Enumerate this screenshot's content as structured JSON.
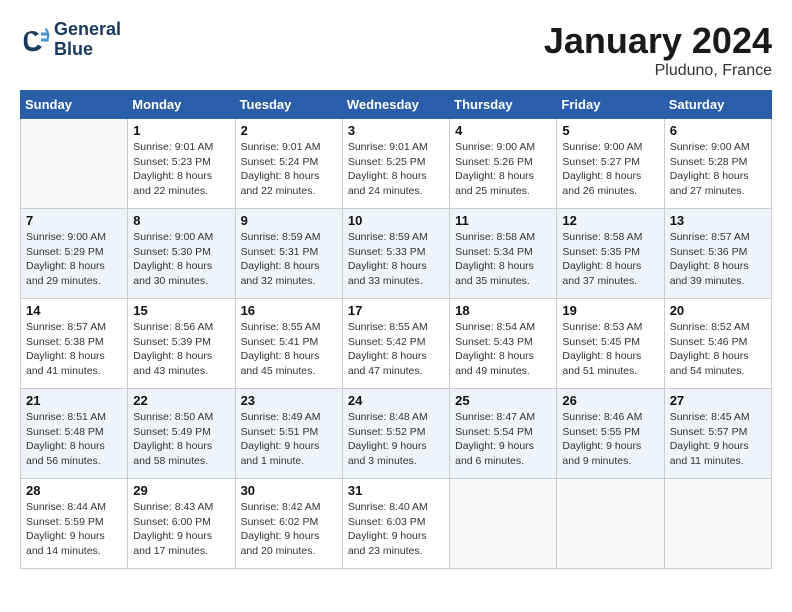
{
  "header": {
    "logo_line1": "General",
    "logo_line2": "Blue",
    "month": "January 2024",
    "location": "Pluduno, France"
  },
  "weekdays": [
    "Sunday",
    "Monday",
    "Tuesday",
    "Wednesday",
    "Thursday",
    "Friday",
    "Saturday"
  ],
  "weeks": [
    [
      {
        "day": "",
        "sunrise": "",
        "sunset": "",
        "daylight": ""
      },
      {
        "day": "1",
        "sunrise": "Sunrise: 9:01 AM",
        "sunset": "Sunset: 5:23 PM",
        "daylight": "Daylight: 8 hours and 22 minutes."
      },
      {
        "day": "2",
        "sunrise": "Sunrise: 9:01 AM",
        "sunset": "Sunset: 5:24 PM",
        "daylight": "Daylight: 8 hours and 22 minutes."
      },
      {
        "day": "3",
        "sunrise": "Sunrise: 9:01 AM",
        "sunset": "Sunset: 5:25 PM",
        "daylight": "Daylight: 8 hours and 24 minutes."
      },
      {
        "day": "4",
        "sunrise": "Sunrise: 9:00 AM",
        "sunset": "Sunset: 5:26 PM",
        "daylight": "Daylight: 8 hours and 25 minutes."
      },
      {
        "day": "5",
        "sunrise": "Sunrise: 9:00 AM",
        "sunset": "Sunset: 5:27 PM",
        "daylight": "Daylight: 8 hours and 26 minutes."
      },
      {
        "day": "6",
        "sunrise": "Sunrise: 9:00 AM",
        "sunset": "Sunset: 5:28 PM",
        "daylight": "Daylight: 8 hours and 27 minutes."
      }
    ],
    [
      {
        "day": "7",
        "sunrise": "Sunrise: 9:00 AM",
        "sunset": "Sunset: 5:29 PM",
        "daylight": "Daylight: 8 hours and 29 minutes."
      },
      {
        "day": "8",
        "sunrise": "Sunrise: 9:00 AM",
        "sunset": "Sunset: 5:30 PM",
        "daylight": "Daylight: 8 hours and 30 minutes."
      },
      {
        "day": "9",
        "sunrise": "Sunrise: 8:59 AM",
        "sunset": "Sunset: 5:31 PM",
        "daylight": "Daylight: 8 hours and 32 minutes."
      },
      {
        "day": "10",
        "sunrise": "Sunrise: 8:59 AM",
        "sunset": "Sunset: 5:33 PM",
        "daylight": "Daylight: 8 hours and 33 minutes."
      },
      {
        "day": "11",
        "sunrise": "Sunrise: 8:58 AM",
        "sunset": "Sunset: 5:34 PM",
        "daylight": "Daylight: 8 hours and 35 minutes."
      },
      {
        "day": "12",
        "sunrise": "Sunrise: 8:58 AM",
        "sunset": "Sunset: 5:35 PM",
        "daylight": "Daylight: 8 hours and 37 minutes."
      },
      {
        "day": "13",
        "sunrise": "Sunrise: 8:57 AM",
        "sunset": "Sunset: 5:36 PM",
        "daylight": "Daylight: 8 hours and 39 minutes."
      }
    ],
    [
      {
        "day": "14",
        "sunrise": "Sunrise: 8:57 AM",
        "sunset": "Sunset: 5:38 PM",
        "daylight": "Daylight: 8 hours and 41 minutes."
      },
      {
        "day": "15",
        "sunrise": "Sunrise: 8:56 AM",
        "sunset": "Sunset: 5:39 PM",
        "daylight": "Daylight: 8 hours and 43 minutes."
      },
      {
        "day": "16",
        "sunrise": "Sunrise: 8:55 AM",
        "sunset": "Sunset: 5:41 PM",
        "daylight": "Daylight: 8 hours and 45 minutes."
      },
      {
        "day": "17",
        "sunrise": "Sunrise: 8:55 AM",
        "sunset": "Sunset: 5:42 PM",
        "daylight": "Daylight: 8 hours and 47 minutes."
      },
      {
        "day": "18",
        "sunrise": "Sunrise: 8:54 AM",
        "sunset": "Sunset: 5:43 PM",
        "daylight": "Daylight: 8 hours and 49 minutes."
      },
      {
        "day": "19",
        "sunrise": "Sunrise: 8:53 AM",
        "sunset": "Sunset: 5:45 PM",
        "daylight": "Daylight: 8 hours and 51 minutes."
      },
      {
        "day": "20",
        "sunrise": "Sunrise: 8:52 AM",
        "sunset": "Sunset: 5:46 PM",
        "daylight": "Daylight: 8 hours and 54 minutes."
      }
    ],
    [
      {
        "day": "21",
        "sunrise": "Sunrise: 8:51 AM",
        "sunset": "Sunset: 5:48 PM",
        "daylight": "Daylight: 8 hours and 56 minutes."
      },
      {
        "day": "22",
        "sunrise": "Sunrise: 8:50 AM",
        "sunset": "Sunset: 5:49 PM",
        "daylight": "Daylight: 8 hours and 58 minutes."
      },
      {
        "day": "23",
        "sunrise": "Sunrise: 8:49 AM",
        "sunset": "Sunset: 5:51 PM",
        "daylight": "Daylight: 9 hours and 1 minute."
      },
      {
        "day": "24",
        "sunrise": "Sunrise: 8:48 AM",
        "sunset": "Sunset: 5:52 PM",
        "daylight": "Daylight: 9 hours and 3 minutes."
      },
      {
        "day": "25",
        "sunrise": "Sunrise: 8:47 AM",
        "sunset": "Sunset: 5:54 PM",
        "daylight": "Daylight: 9 hours and 6 minutes."
      },
      {
        "day": "26",
        "sunrise": "Sunrise: 8:46 AM",
        "sunset": "Sunset: 5:55 PM",
        "daylight": "Daylight: 9 hours and 9 minutes."
      },
      {
        "day": "27",
        "sunrise": "Sunrise: 8:45 AM",
        "sunset": "Sunset: 5:57 PM",
        "daylight": "Daylight: 9 hours and 11 minutes."
      }
    ],
    [
      {
        "day": "28",
        "sunrise": "Sunrise: 8:44 AM",
        "sunset": "Sunset: 5:59 PM",
        "daylight": "Daylight: 9 hours and 14 minutes."
      },
      {
        "day": "29",
        "sunrise": "Sunrise: 8:43 AM",
        "sunset": "Sunset: 6:00 PM",
        "daylight": "Daylight: 9 hours and 17 minutes."
      },
      {
        "day": "30",
        "sunrise": "Sunrise: 8:42 AM",
        "sunset": "Sunset: 6:02 PM",
        "daylight": "Daylight: 9 hours and 20 minutes."
      },
      {
        "day": "31",
        "sunrise": "Sunrise: 8:40 AM",
        "sunset": "Sunset: 6:03 PM",
        "daylight": "Daylight: 9 hours and 23 minutes."
      },
      {
        "day": "",
        "sunrise": "",
        "sunset": "",
        "daylight": ""
      },
      {
        "day": "",
        "sunrise": "",
        "sunset": "",
        "daylight": ""
      },
      {
        "day": "",
        "sunrise": "",
        "sunset": "",
        "daylight": ""
      }
    ]
  ]
}
